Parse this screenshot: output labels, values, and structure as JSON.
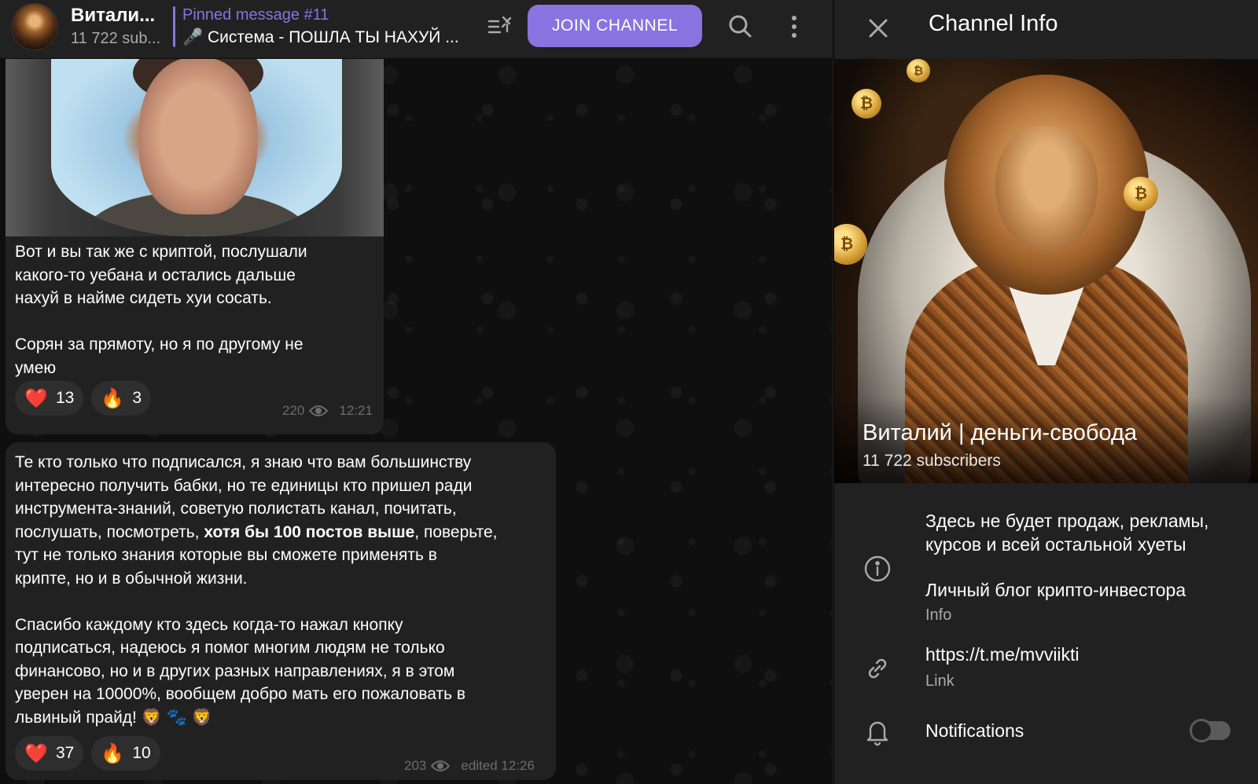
{
  "header": {
    "channel_title": "Витали...",
    "channel_subs": "11 722 sub...",
    "pinned_title": "Pinned message #11",
    "pinned_text": "🎤 Система - ПОШЛА ТЫ НАХУЙ ...",
    "join_label": "JOIN CHANNEL",
    "icons": {
      "pinned_list": "pinned-list-icon",
      "search": "search-icon",
      "more": "more-vertical-icon"
    }
  },
  "messages": [
    {
      "lines": [
        "Вот и вы так же с криптой, послушали",
        "какого-то уебана и остались дальше",
        "нахуй в найме сидеть хуи сосать.",
        "",
        "Сорян за прямоту, но я по другому не",
        "умею"
      ],
      "reactions": [
        {
          "emoji": "❤️",
          "count": "13"
        },
        {
          "emoji": "🔥",
          "count": "3"
        }
      ],
      "views": "220",
      "time": "12:21"
    },
    {
      "lines_before_bold": [
        "Те кто только что подписался, я знаю что вам большинству",
        "интересно получить бабки, но те единицы кто пришел ради",
        "инструмента-знаний, советую полистать канал, почитать,"
      ],
      "line4_start": "послушать, посмотреть, ",
      "line4_bold": "хотя бы 100 постов выше",
      "line4_end": ", поверьте,",
      "lines_after": [
        "тут не только знания которые вы сможете применять в",
        "крипте, но и в обычной жизни.",
        "",
        "Спасибо каждому кто здесь когда-то нажал кнопку",
        "подписаться, надеюсь я помог многим людям не только",
        "финансово, но и в других разных направлениях, я в этом",
        "уверен на 10000%, вообщем добро мать его пожаловать в",
        "львиный прайд! 🦁 🐾 🦁"
      ],
      "reactions": [
        {
          "emoji": "❤️",
          "count": "37"
        },
        {
          "emoji": "🔥",
          "count": "10"
        }
      ],
      "views": "203",
      "time": "edited 12:26"
    }
  ],
  "panel": {
    "title": "Channel Info",
    "cover_name": "Виталий | деньги-свобода",
    "cover_subs": "11 722 subscribers",
    "info_lines": [
      "Здесь не будет продаж, рекламы,",
      "курсов и всей остальной хуеты",
      "",
      "Личный блог крипто-инвестора"
    ],
    "info_label": "Info",
    "link_value": "https://t.me/mvviikti",
    "link_label": "Link",
    "notifications_label": "Notifications",
    "notifications_enabled": false
  },
  "colors": {
    "accent": "#8774e1",
    "bubble": "#212121",
    "background": "#0f0f0f"
  }
}
